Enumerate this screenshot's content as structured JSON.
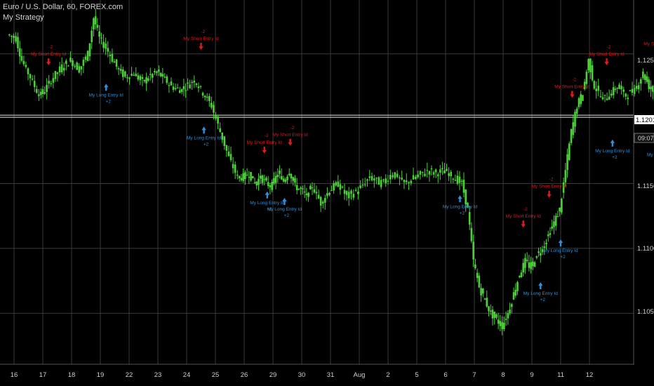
{
  "header": {
    "symbol_line": "Euro / U.S. Dollar, 60, FOREX.com",
    "strategy_name": "My Strategy"
  },
  "price_axis": {
    "ticks": [
      "1.12500",
      "1.12019",
      "1.11500",
      "1.11000",
      "1.10500"
    ],
    "current_price": "1.12019",
    "countdown": "09:07"
  },
  "time_axis": {
    "labels": [
      "16",
      "17",
      "18",
      "19",
      "22",
      "23",
      "24",
      "25",
      "26",
      "29",
      "30",
      "31",
      "Aug",
      "2",
      "5",
      "6",
      "7",
      "8",
      "9",
      "11",
      "12"
    ]
  },
  "colors": {
    "background": "#000000",
    "grid": "#3a3a3a",
    "candle": "#4cd137",
    "short_signal": "#e01b1b",
    "long_signal": "#2f8fd8",
    "axis_text": "#cfcfcf"
  },
  "chart_data": {
    "type": "candlestick",
    "symbol": "EURUSD",
    "timeframe": "60",
    "ylim": [
      1.1028,
      1.1285
    ],
    "grid": true,
    "close_path": [
      [
        15.8,
        1.1265
      ],
      [
        16.1,
        1.1262
      ],
      [
        16.3,
        1.1245
      ],
      [
        16.6,
        1.1232
      ],
      [
        16.9,
        1.1218
      ],
      [
        17.1,
        1.1222
      ],
      [
        17.4,
        1.1232
      ],
      [
        17.7,
        1.124
      ],
      [
        18.0,
        1.1245
      ],
      [
        18.3,
        1.1238
      ],
      [
        18.6,
        1.125
      ],
      [
        18.8,
        1.1278
      ],
      [
        19.0,
        1.1262
      ],
      [
        19.3,
        1.1252
      ],
      [
        19.6,
        1.124
      ],
      [
        19.9,
        1.1232
      ],
      [
        20.2,
        1.1235
      ],
      [
        20.5,
        1.1228
      ],
      [
        20.7,
        1.1232
      ],
      [
        21.0,
        1.1236
      ],
      [
        21.2,
        1.1232
      ],
      [
        21.5,
        1.1225
      ],
      [
        21.8,
        1.1222
      ],
      [
        22.0,
        1.1225
      ],
      [
        22.3,
        1.123
      ],
      [
        22.6,
        1.122
      ],
      [
        22.9,
        1.121
      ],
      [
        23.2,
        1.119
      ],
      [
        23.5,
        1.117
      ],
      [
        23.8,
        1.1155
      ],
      [
        24.0,
        1.1155
      ],
      [
        24.2,
        1.1158
      ],
      [
        24.4,
        1.115
      ],
      [
        24.6,
        1.1155
      ],
      [
        24.8,
        1.115
      ],
      [
        25.0,
        1.1148
      ],
      [
        25.2,
        1.1158
      ],
      [
        25.4,
        1.1152
      ],
      [
        25.6,
        1.116
      ],
      [
        25.8,
        1.1148
      ],
      [
        26.0,
        1.1145
      ],
      [
        26.2,
        1.114
      ],
      [
        26.4,
        1.1148
      ],
      [
        26.7,
        1.1135
      ],
      [
        27.0,
        1.1145
      ],
      [
        27.3,
        1.115
      ],
      [
        27.6,
        1.114
      ],
      [
        28.0,
        1.1145
      ],
      [
        28.4,
        1.1155
      ],
      [
        28.8,
        1.115
      ],
      [
        29.2,
        1.1158
      ],
      [
        29.6,
        1.115
      ],
      [
        30.0,
        1.1155
      ],
      [
        30.4,
        1.116
      ],
      [
        30.7,
        1.1158
      ],
      [
        31.0,
        1.116
      ],
      [
        31.3,
        1.1155
      ],
      [
        31.6,
        1.115
      ],
      [
        31.8,
        1.113
      ],
      [
        32.0,
        1.109
      ],
      [
        32.2,
        1.107
      ],
      [
        32.4,
        1.106
      ],
      [
        32.6,
        1.105
      ],
      [
        32.8,
        1.1045
      ],
      [
        33.0,
        1.104
      ],
      [
        33.2,
        1.105
      ],
      [
        33.4,
        1.1065
      ],
      [
        33.6,
        1.108
      ],
      [
        33.8,
        1.109
      ],
      [
        34.0,
        1.1085
      ],
      [
        34.2,
        1.1095
      ],
      [
        34.4,
        1.11
      ],
      [
        34.6,
        1.111
      ],
      [
        34.8,
        1.112
      ],
      [
        35.0,
        1.113
      ],
      [
        35.2,
        1.116
      ],
      [
        35.4,
        1.119
      ],
      [
        35.6,
        1.121
      ],
      [
        35.8,
        1.122
      ],
      [
        36.0,
        1.1245
      ],
      [
        36.2,
        1.1225
      ],
      [
        36.5,
        1.1215
      ],
      [
        36.8,
        1.122
      ],
      [
        37.0,
        1.1225
      ],
      [
        37.3,
        1.1218
      ],
      [
        37.6,
        1.1222
      ],
      [
        37.9,
        1.1235
      ],
      [
        38.1,
        1.1225
      ],
      [
        38.3,
        1.122
      ],
      [
        38.6,
        1.1215
      ],
      [
        38.8,
        1.1205
      ],
      [
        39.0,
        1.121
      ],
      [
        39.2,
        1.1215
      ],
      [
        39.4,
        1.1218
      ],
      [
        39.6,
        1.1215
      ]
    ],
    "short_signals": [
      {
        "x": 17.2,
        "y": 1.124,
        "label": "My Short Entry Id",
        "qty": "-2"
      },
      {
        "x": 22.5,
        "y": 1.1252,
        "label": "My Short Entry Id",
        "qty": "-2"
      },
      {
        "x": 24.7,
        "y": 1.1172,
        "label": "My Short Entry Id",
        "qty": "-2"
      },
      {
        "x": 25.6,
        "y": 1.1178,
        "label": "My Short Entry Id",
        "qty": "-2"
      },
      {
        "x": 33.7,
        "y": 1.1115,
        "label": "My Short Entry Id",
        "qty": "-2"
      },
      {
        "x": 34.6,
        "y": 1.1138,
        "label": "My Short Entry Id",
        "qty": "-2"
      },
      {
        "x": 35.4,
        "y": 1.1215,
        "label": "My Short Entry Id",
        "qty": "-2"
      },
      {
        "x": 36.6,
        "y": 1.124,
        "label": "My Short Entry Id",
        "qty": "-2"
      },
      {
        "x": 38.5,
        "y": 1.1248,
        "label": "My Short Entry Id",
        "qty": "-2"
      },
      {
        "x": 39.4,
        "y": 1.1238,
        "label": "My Short Entry Id",
        "qty": "-2"
      }
    ],
    "long_signals": [
      {
        "x": 19.2,
        "y": 1.1228,
        "label": "My Long Entry Id",
        "qty": "+2"
      },
      {
        "x": 22.6,
        "y": 1.1195,
        "label": "My Long Entry Id",
        "qty": "+2"
      },
      {
        "x": 24.8,
        "y": 1.1145,
        "label": "My Long Entry Id",
        "qty": "+2"
      },
      {
        "x": 25.4,
        "y": 1.114,
        "label": "My Long Entry Id",
        "qty": "+2"
      },
      {
        "x": 31.5,
        "y": 1.1142,
        "label": "My Long Entry Id",
        "qty": "+2"
      },
      {
        "x": 34.3,
        "y": 1.1075,
        "label": "My Long Entry Id",
        "qty": "+2"
      },
      {
        "x": 35.0,
        "y": 1.1108,
        "label": "My Long Entry Id",
        "qty": "+2"
      },
      {
        "x": 36.8,
        "y": 1.1185,
        "label": "My Long Entry Id",
        "qty": "+2"
      },
      {
        "x": 38.6,
        "y": 1.1182,
        "label": "My Long Entry Id",
        "qty": "+2"
      }
    ]
  }
}
